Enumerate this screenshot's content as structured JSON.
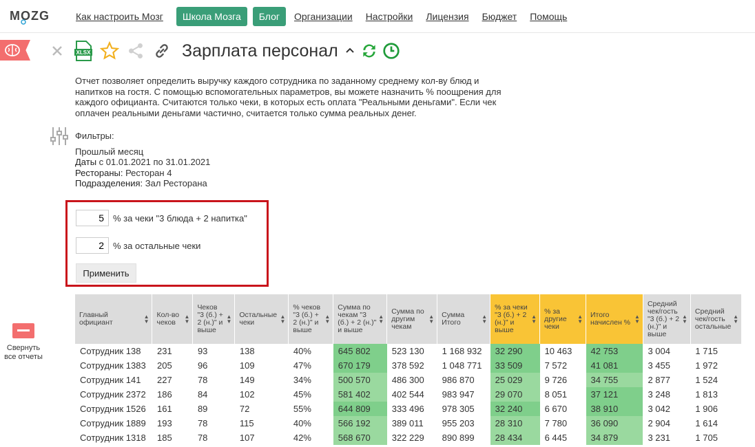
{
  "app": {
    "logo": "MOZG",
    "nav": [
      {
        "label": "Как настроить Мозг",
        "type": "link"
      },
      {
        "label": "Школа Мозга",
        "type": "pill"
      },
      {
        "label": "Блог",
        "type": "pill"
      },
      {
        "label": "Организации",
        "type": "link"
      },
      {
        "label": "Настройки",
        "type": "link"
      },
      {
        "label": "Лицензия",
        "type": "link"
      },
      {
        "label": "Бюджет",
        "type": "link"
      },
      {
        "label": "Помощь",
        "type": "link"
      }
    ],
    "accent_color": "#3a9e78",
    "alert_color": "#f36e6e"
  },
  "sidebar": {
    "collapse_label": "Свернуть все отчеты"
  },
  "toolbar": {
    "title": "Зарплата персонал",
    "icons": [
      "close-icon",
      "xlsx-icon",
      "star-icon",
      "share-icon",
      "link-icon",
      "caret-up-icon",
      "refresh-icon",
      "clock-icon"
    ],
    "xlsx_label": "XLSX"
  },
  "description": "Отчет позволяет определить выручку каждого сотрудника по заданному среднему кол-ву блюд и напитков на гостя. С помощью вспомогательных параметров, вы можете назначить % поощрения для каждого официанта. Считаются только чеки, в которых есть оплата \"Реальными деньгами\". Если чек оплачен реальными деньгами частично, считается только сумма реальных денег.",
  "filters": {
    "header": "Фильтры:",
    "period": "Прошлый месяц",
    "dates_label": "Даты",
    "dates_value": " с 01.01.2021 по 31.01.2021",
    "restaurants_label": "Рестораны:",
    "restaurants_value": " Ресторан 4",
    "divisions_label": "Подразделения:",
    "divisions_value": " Зал Ресторана"
  },
  "params": {
    "p1_value": "5",
    "p1_label": "% за чеки \"3 блюда + 2 напитка\"",
    "p2_value": "2",
    "p2_label": "% за остальные чеки",
    "apply_label": "Применить"
  },
  "table": {
    "columns": [
      "Главный официант",
      "Кол-во чеков",
      "Чеков \"3 (б.) + 2 (н.)\" и выше",
      "Остальные чеки",
      "% чеков \"3 (б.) + 2 (н.)\" и выше",
      "Сумма по чекам \"3 (б.) + 2 (н.)\" и выше",
      "Сумма по другим чекам",
      "Сумма Итого",
      "% за чеки \"3 (б.) + 2 (н.)\" и выше",
      "% за другие чеки",
      "Итого начислен %",
      "Средний чек/гость \"3 (б.) + 2 (н.)\" и выше",
      "Средний чек/гость остальные"
    ],
    "highlight_header_color": "#f9c436",
    "rows": [
      [
        "Сотрудник 138",
        "231",
        "93",
        "138",
        "40%",
        "645 802",
        "523 130",
        "1 168 932",
        "32 290",
        "10 463",
        "42 753",
        "3 004",
        "1 715"
      ],
      [
        "Сотрудник 1383",
        "205",
        "96",
        "109",
        "47%",
        "670 179",
        "378 592",
        "1 048 771",
        "33 509",
        "7 572",
        "41 081",
        "3 455",
        "1 972"
      ],
      [
        "Сотрудник 141",
        "227",
        "78",
        "149",
        "34%",
        "500 570",
        "486 300",
        "986 870",
        "25 029",
        "9 726",
        "34 755",
        "2 877",
        "1 524"
      ],
      [
        "Сотрудник 2372",
        "186",
        "84",
        "102",
        "45%",
        "581 402",
        "402 544",
        "983 947",
        "29 070",
        "8 051",
        "37 121",
        "3 248",
        "1 813"
      ],
      [
        "Сотрудник 1526",
        "161",
        "89",
        "72",
        "55%",
        "644 809",
        "333 496",
        "978 305",
        "32 240",
        "6 670",
        "38 910",
        "3 042",
        "1 906"
      ],
      [
        "Сотрудник 1889",
        "193",
        "78",
        "115",
        "40%",
        "566 192",
        "389 011",
        "955 203",
        "28 310",
        "7 780",
        "36 090",
        "2 904",
        "1 614"
      ],
      [
        "Сотрудник 1318",
        "185",
        "78",
        "107",
        "42%",
        "568 670",
        "322 229",
        "890 899",
        "28 434",
        "6 445",
        "34 879",
        "3 231",
        "1 705"
      ]
    ]
  }
}
